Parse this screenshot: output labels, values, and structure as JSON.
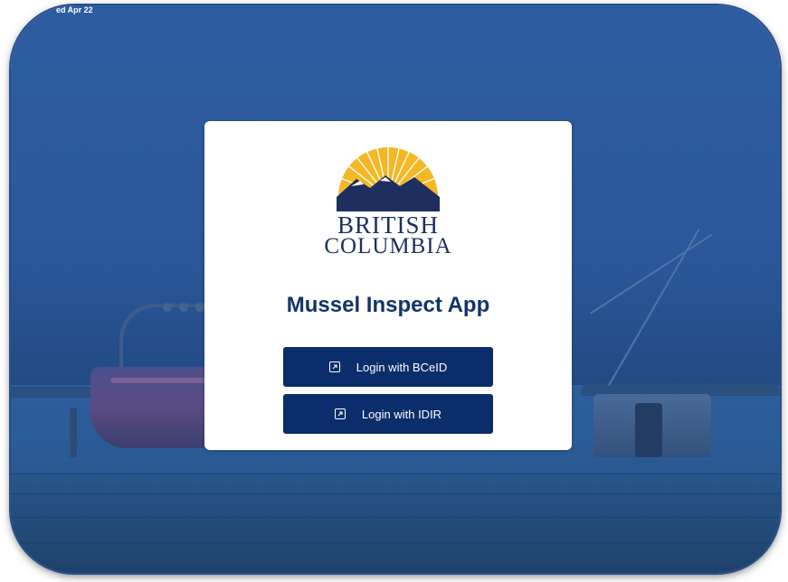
{
  "status_bar": {
    "date": "ed Apr 22"
  },
  "logo": {
    "line1": "BRITISH",
    "line2": "COLUMBIA",
    "colors": {
      "sun": "#f5b824",
      "mountains": "#1d2f5e"
    }
  },
  "login_card": {
    "title": "Mussel Inspect App",
    "buttons": [
      {
        "label": "Login with BCeID",
        "icon": "external-link-icon"
      },
      {
        "label": "Login with IDIR",
        "icon": "external-link-icon"
      }
    ]
  },
  "colors": {
    "primary": "#0c2d6b",
    "title": "#12336a",
    "background_overlay": "#2a5799"
  }
}
